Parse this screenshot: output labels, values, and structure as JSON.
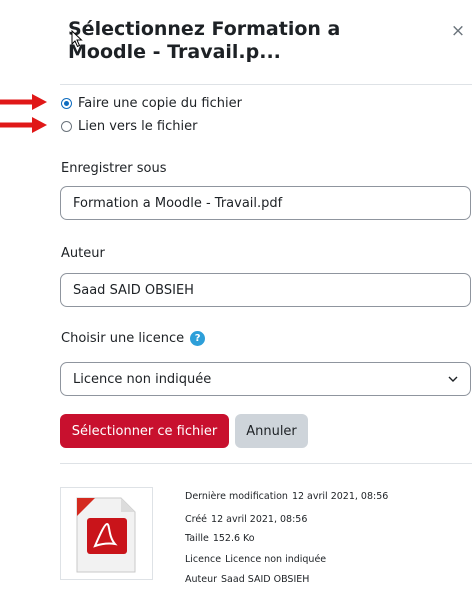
{
  "dialog": {
    "title": "Sélectionnez Formation a Moodle - Travail.p...",
    "close_symbol": "×"
  },
  "options": {
    "copy_label": "Faire une copie du fichier",
    "link_label": "Lien vers le fichier",
    "selected": "copy"
  },
  "save_as": {
    "label": "Enregistrer sous",
    "value": "Formation a Moodle - Travail.pdf"
  },
  "author": {
    "label": "Auteur",
    "value": "Saad SAID OBSIEH"
  },
  "license": {
    "label": "Choisir une licence",
    "help_symbol": "?",
    "selected": "Licence non indiquée",
    "chevron": "⌄"
  },
  "buttons": {
    "select_label": "Sélectionner ce fichier",
    "cancel_label": "Annuler"
  },
  "file_info": {
    "modified_key": "Dernière modification",
    "modified_value": "12 avril 2021, 08:56",
    "created_key": "Créé",
    "created_value": "12 avril 2021, 08:56",
    "size_key": "Taille",
    "size_value": "152.6 Ko",
    "license_key": "Licence",
    "license_value": "Licence non indiquée",
    "author_key": "Auteur",
    "author_value": "Saad SAID OBSIEH"
  },
  "icons": {
    "close": "close-icon",
    "help": "help-icon",
    "file_thumbnail": "pdf-file-icon",
    "annotation_arrows": "red-arrow-icon"
  },
  "colors": {
    "primary_button": "#c8102e",
    "secondary_button": "#ced4da",
    "radio_accent": "#0f6cbf",
    "help_icon": "#2d9fd9",
    "arrow": "#e01818"
  }
}
